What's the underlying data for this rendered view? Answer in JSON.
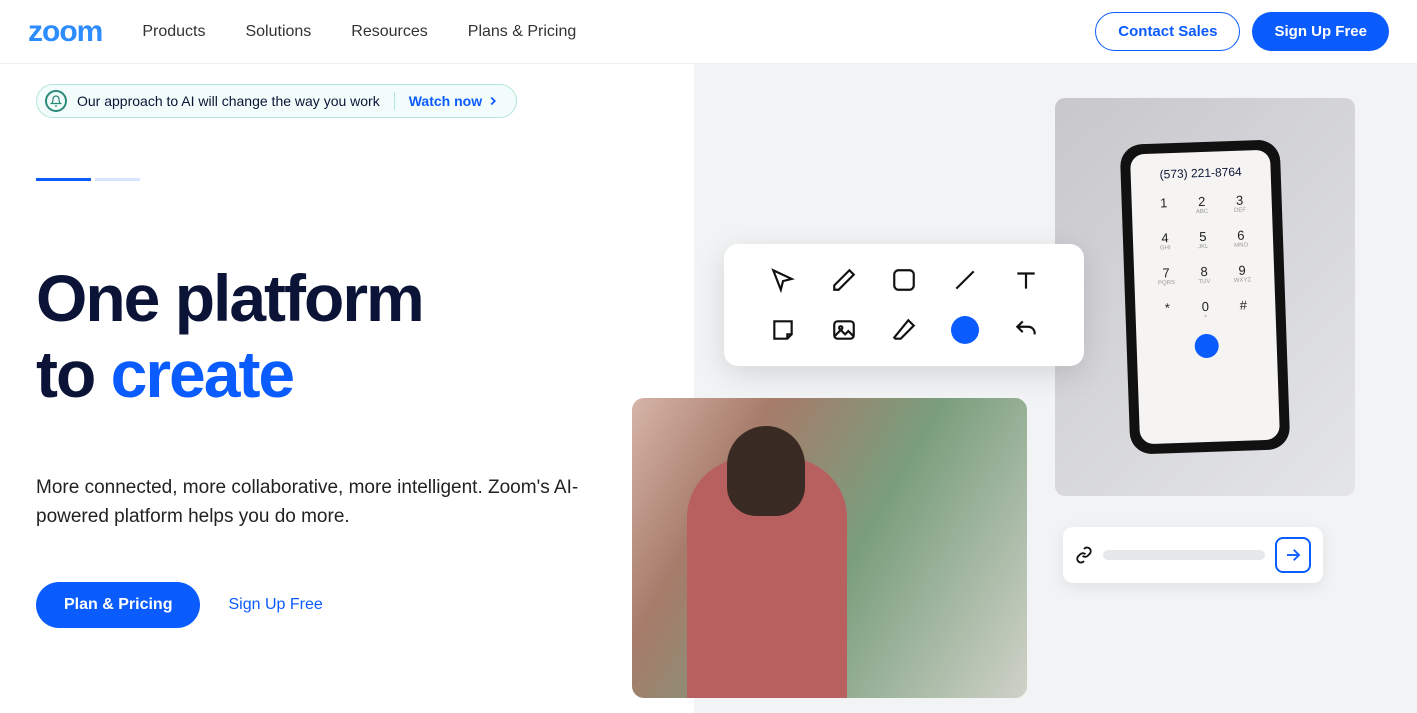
{
  "header": {
    "logo_text": "zoom",
    "nav": [
      "Products",
      "Solutions",
      "Resources",
      "Plans & Pricing"
    ],
    "contact_label": "Contact Sales",
    "signup_label": "Sign Up Free"
  },
  "banner": {
    "text": "Our approach to AI will change the way you work",
    "link_label": "Watch now"
  },
  "hero": {
    "title_line1": "One platform",
    "title_line2_prefix": "to ",
    "title_line2_accent": "create",
    "subtitle": "More connected, more collaborative, more intelligent. Zoom's AI-powered platform helps you do more.",
    "cta_primary": "Plan & Pricing",
    "cta_secondary": "Sign Up Free"
  },
  "phone": {
    "number": "(573) 221-8764",
    "keys": [
      "1",
      "2",
      "3",
      "4",
      "5",
      "6",
      "7",
      "8",
      "9",
      "*",
      "0",
      "#"
    ],
    "subs": [
      "",
      "ABC",
      "DEF",
      "GHI",
      "JKL",
      "MNO",
      "PQRS",
      "TUV",
      "WXYZ",
      "",
      "+",
      ""
    ]
  }
}
